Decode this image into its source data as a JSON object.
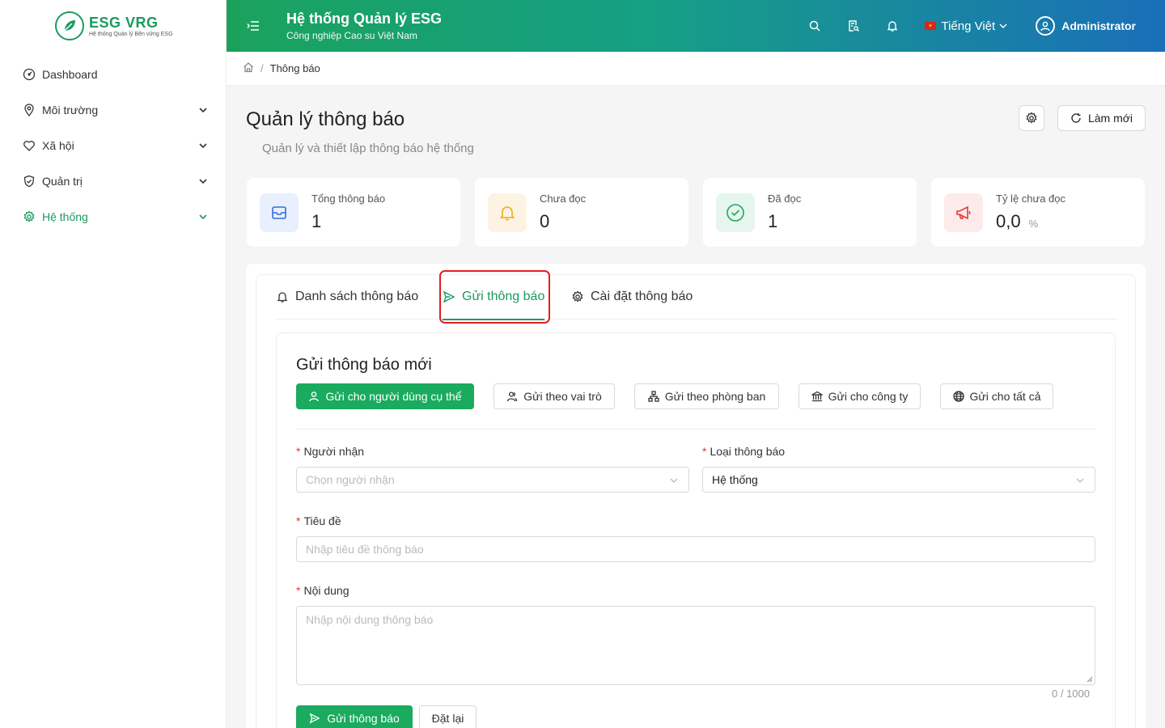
{
  "brand": {
    "name": "ESG VRG",
    "tagline": "Hệ thống Quản lý Bền vững ESG",
    "color": "#1a9b5e"
  },
  "sidebar": {
    "items": [
      {
        "label": "Dashboard",
        "icon": "dashboard-icon",
        "expandable": false,
        "active": false
      },
      {
        "label": "Môi trường",
        "icon": "map-pin-icon",
        "expandable": true,
        "active": false
      },
      {
        "label": "Xã hội",
        "icon": "heart-icon",
        "expandable": true,
        "active": false
      },
      {
        "label": "Quản trị",
        "icon": "shield-check-icon",
        "expandable": true,
        "active": false
      },
      {
        "label": "Hệ thống",
        "icon": "gear-icon",
        "expandable": true,
        "active": true
      }
    ]
  },
  "header": {
    "title": "Hệ thống Quản lý ESG",
    "subtitle": "Công nghiệp Cao su Việt Nam",
    "language": "Tiếng Việt",
    "user": "Administrator",
    "gradient": [
      "#1aa25c",
      "#16a085",
      "#1a6fb8"
    ]
  },
  "breadcrumb": {
    "current": "Thông báo",
    "separator": "/"
  },
  "page": {
    "title": "Quản lý thông báo",
    "subtitle": "Quản lý và thiết lập thông báo hệ thống",
    "refresh_label": "Làm mới"
  },
  "stats": [
    {
      "label": "Tổng thông báo",
      "value": "1",
      "icon": "inbox-icon",
      "color": "#2f6fdf",
      "bg": "#e8f0fd"
    },
    {
      "label": "Chưa đọc",
      "value": "0",
      "icon": "bell-icon",
      "color": "#f5a623",
      "bg": "#fdf3e3"
    },
    {
      "label": "Đã đọc",
      "value": "1",
      "icon": "check-circle-icon",
      "color": "#1aab5f",
      "bg": "#e6f6ee"
    },
    {
      "label": "Tỷ lệ chưa đọc",
      "value": "0,0",
      "unit": "%",
      "icon": "megaphone-icon",
      "color": "#e53935",
      "bg": "#fdeaea"
    }
  ],
  "tabs": [
    {
      "label": "Danh sách thông báo",
      "icon": "bell-icon",
      "active": false
    },
    {
      "label": "Gửi thông báo",
      "icon": "send-icon",
      "active": true
    },
    {
      "label": "Cài đặt thông báo",
      "icon": "gear-icon",
      "active": false
    }
  ],
  "form": {
    "title": "Gửi thông báo mới",
    "modes": [
      {
        "label": "Gửi cho người dùng cụ thể",
        "icon": "user-icon",
        "active": true
      },
      {
        "label": "Gửi theo vai trò",
        "icon": "users-icon",
        "active": false
      },
      {
        "label": "Gửi theo phòng ban",
        "icon": "org-chart-icon",
        "active": false
      },
      {
        "label": "Gửi cho công ty",
        "icon": "bank-icon",
        "active": false
      },
      {
        "label": "Gửi cho tất cả",
        "icon": "globe-icon",
        "active": false
      }
    ],
    "recipient": {
      "label": "Người nhận",
      "placeholder": "Chọn người nhận"
    },
    "type": {
      "label": "Loại thông báo",
      "value": "Hệ thống"
    },
    "subject": {
      "label": "Tiêu đề",
      "placeholder": "Nhập tiêu đề thông báo"
    },
    "content": {
      "label": "Nội dung",
      "placeholder": "Nhập nội dung thông báo",
      "counter": "0 / 1000"
    },
    "submit_label": "Gửi thông báo",
    "reset_label": "Đặt lại"
  }
}
